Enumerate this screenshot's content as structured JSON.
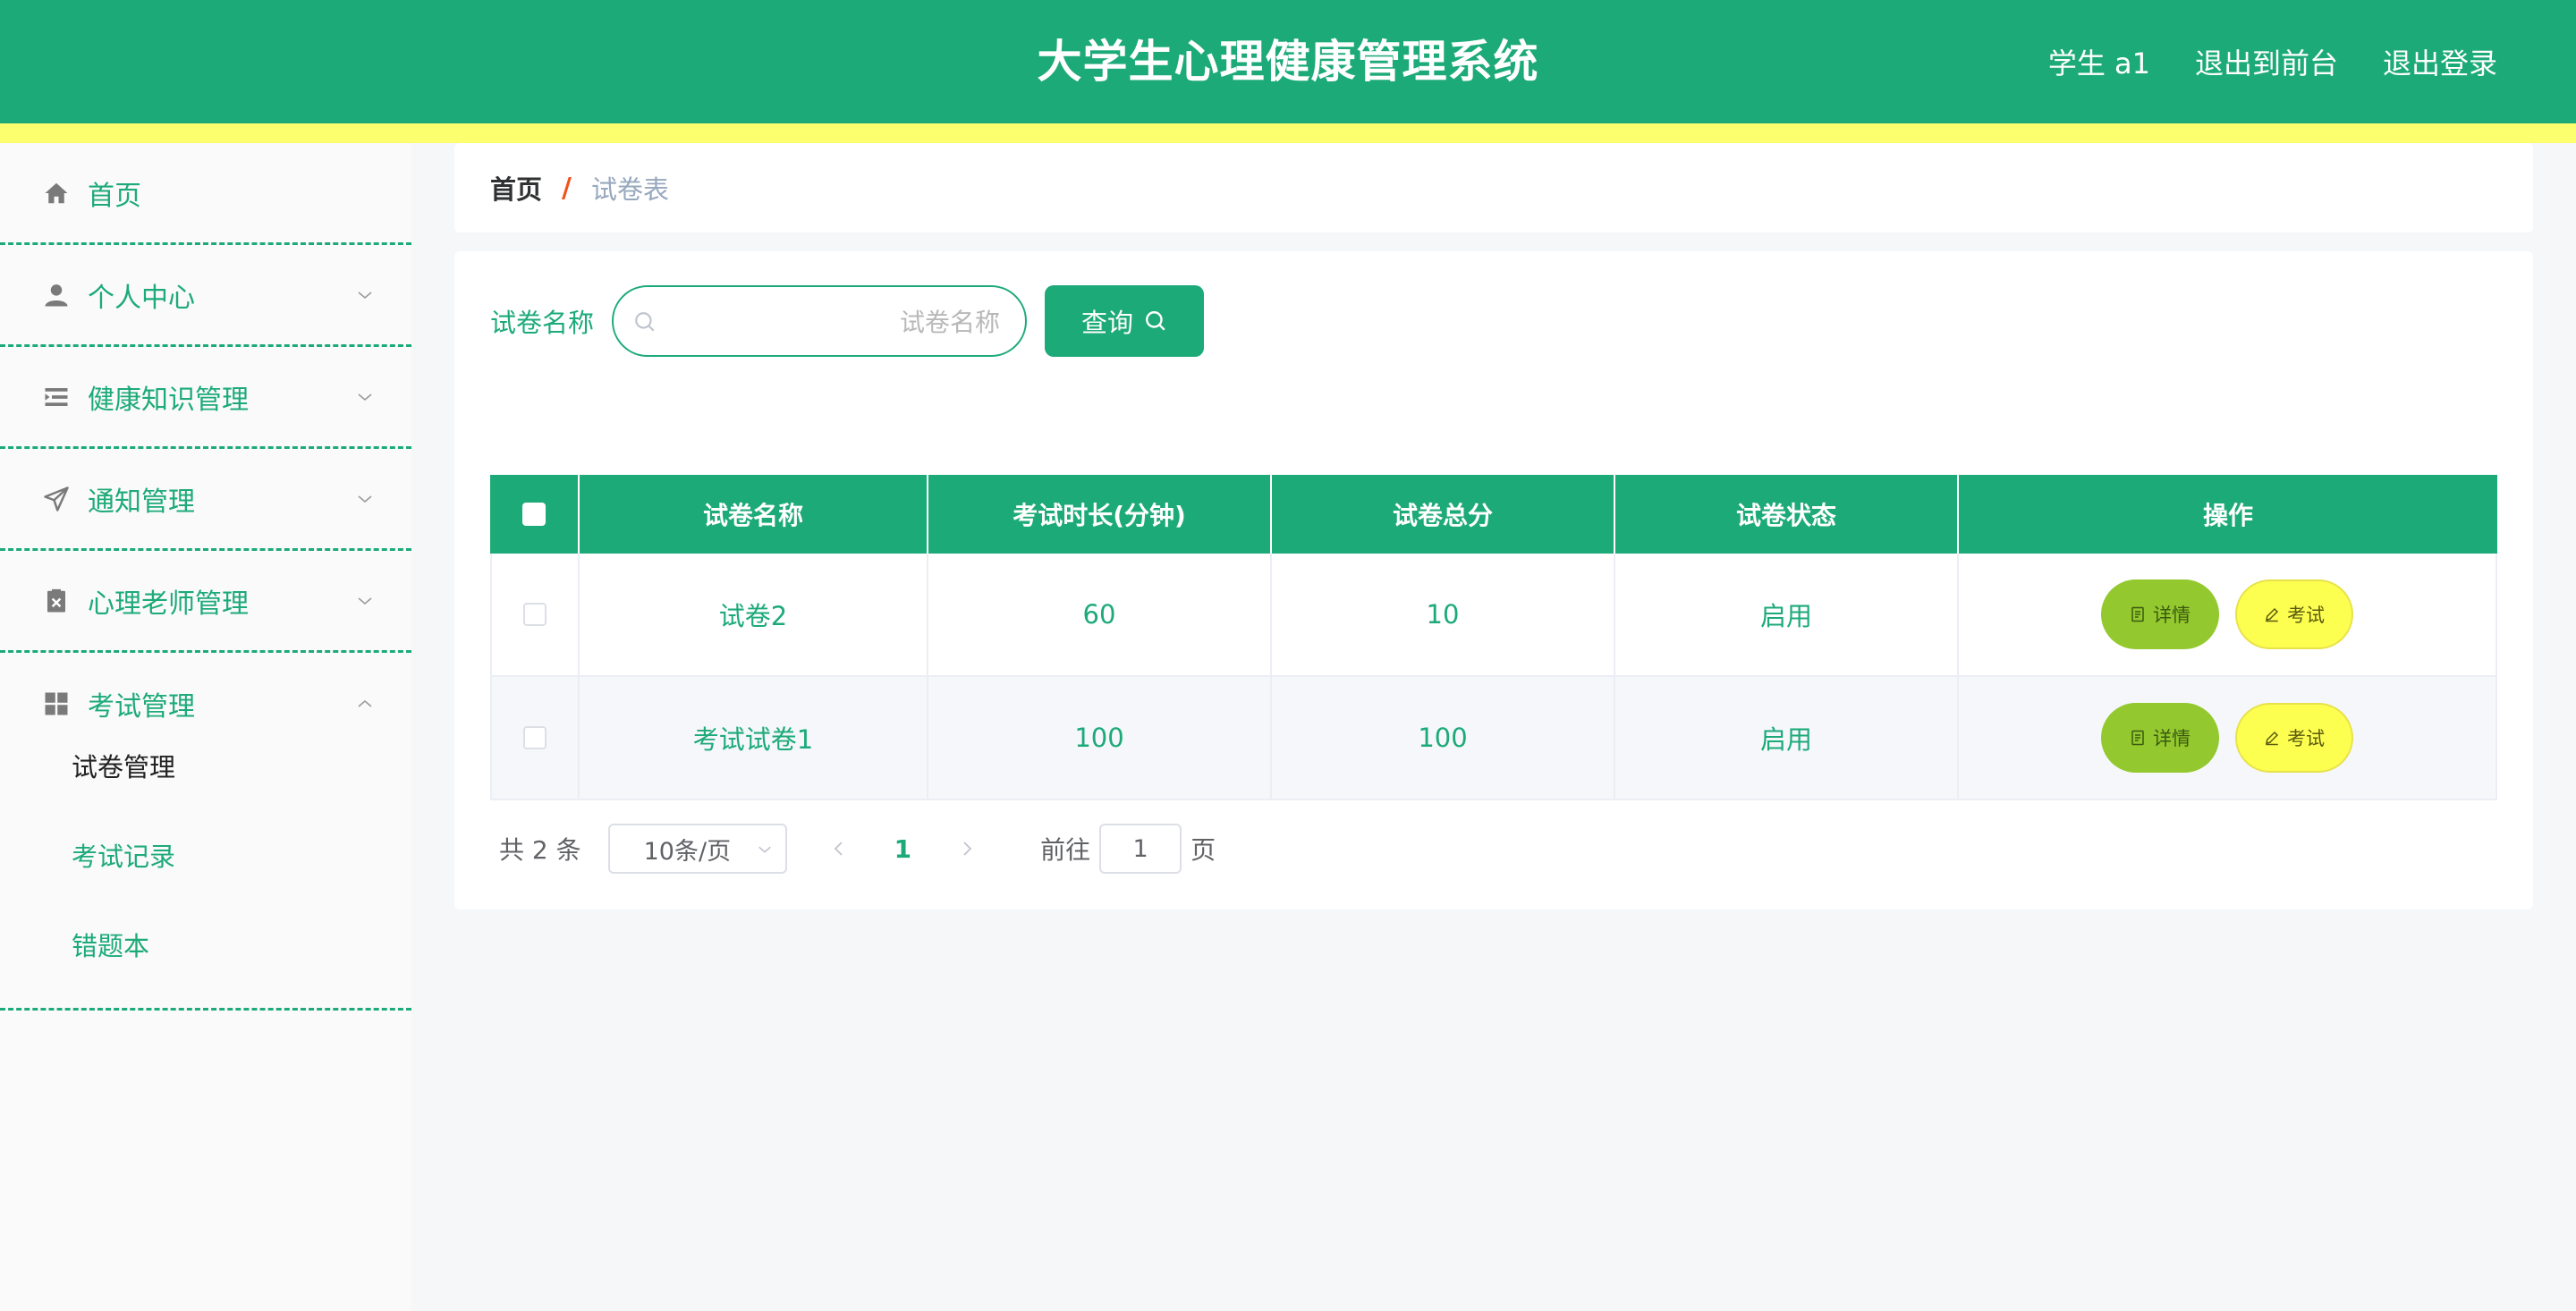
{
  "header": {
    "title": "大学生心理健康管理系统",
    "user_label": "学生 a1",
    "front_link": "退出到前台",
    "logout_link": "退出登录",
    "bg_color": "#1daa79",
    "stripe_color": "#fcff6e"
  },
  "sidebar": {
    "items": [
      {
        "label": "首页",
        "icon": "home-icon"
      },
      {
        "label": "个人中心",
        "icon": "user-icon"
      },
      {
        "label": "健康知识管理",
        "icon": "list-icon"
      },
      {
        "label": "通知管理",
        "icon": "send-icon"
      },
      {
        "label": "心理老师管理",
        "icon": "clipboard-icon"
      },
      {
        "label": "考试管理",
        "icon": "grid-icon"
      }
    ],
    "sub_items": [
      {
        "label": "试卷管理",
        "active": true
      },
      {
        "label": "考试记录",
        "active": false
      },
      {
        "label": "错题本",
        "active": false
      }
    ]
  },
  "breadcrumb": {
    "home": "首页",
    "separator": "/",
    "current": "试卷表"
  },
  "search": {
    "label": "试卷名称",
    "placeholder": "试卷名称",
    "value": "",
    "button_label": "查询"
  },
  "table": {
    "columns": [
      "试卷名称",
      "考试时长(分钟)",
      "试卷总分",
      "试卷状态",
      "操作"
    ],
    "rows": [
      {
        "name": "试卷2",
        "duration": "60",
        "score": "10",
        "status": "启用"
      },
      {
        "name": "考试试卷1",
        "duration": "100",
        "score": "100",
        "status": "启用"
      }
    ],
    "detail_label": "详情",
    "exam_label": "考试"
  },
  "pagination": {
    "total_text": "共 2 条",
    "page_size": "10条/页",
    "current_page": "1",
    "goto_label": "前往",
    "goto_value": "1",
    "goto_suffix": "页"
  }
}
